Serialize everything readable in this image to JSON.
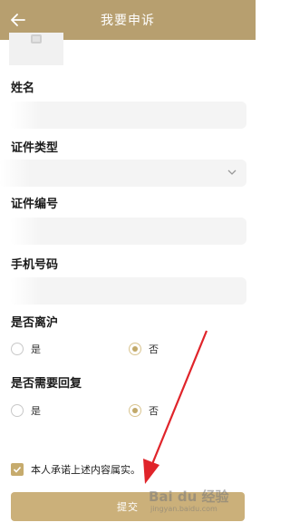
{
  "header": {
    "title": "我要申诉",
    "back_icon": "back-arrow-icon"
  },
  "form": {
    "name_label": "姓名",
    "id_type_label": "证件类型",
    "id_number_label": "证件编号",
    "phone_label": "手机号码",
    "leave_shanghai": {
      "label": "是否离沪",
      "options": [
        "是",
        "否"
      ],
      "selected": "否"
    },
    "need_reply": {
      "label": "是否需要回复",
      "options": [
        "是",
        "否"
      ],
      "selected": "否"
    }
  },
  "agreement": {
    "text": "本人承诺上述内容属实。",
    "checked": true
  },
  "submit_label": "提交",
  "watermark": {
    "logo": "Bai du 经验",
    "url": "jingyan.baidu.com"
  },
  "colors": {
    "header_bg": "#b79f6f",
    "accent": "#c2a96a",
    "submit_bg": "#cbb07a",
    "annotation_arrow": "#e0242a"
  }
}
